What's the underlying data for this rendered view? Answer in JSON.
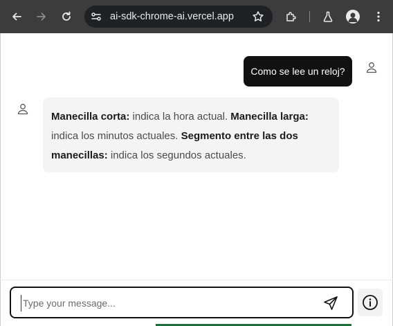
{
  "browser": {
    "url": "ai-sdk-chrome-ai.vercel.app",
    "icons": {
      "back": "arrow-left-icon",
      "forward": "arrow-right-icon",
      "reload": "reload-icon",
      "site_info": "tune-icon",
      "bookmark": "star-icon",
      "extensions": "puzzle-icon",
      "labs": "flask-icon",
      "profile": "person-icon",
      "menu": "kebab-menu-icon"
    }
  },
  "chat": {
    "messages": [
      {
        "role": "user",
        "text": "Como se lee un reloj?"
      },
      {
        "role": "assistant",
        "parts": [
          {
            "bold": true,
            "text": "Manecilla corta:"
          },
          {
            "bold": false,
            "text": " indica la hora actual. "
          },
          {
            "bold": true,
            "text": "Manecilla larga:"
          },
          {
            "bold": false,
            "text": " indica los minutos actuales. "
          },
          {
            "bold": true,
            "text": "Segmento entre las dos manecillas:"
          },
          {
            "bold": false,
            "text": " indica los segundos actuales."
          }
        ]
      }
    ]
  },
  "composer": {
    "placeholder": "Type your message...",
    "send_icon": "send-icon",
    "info_icon": "info-icon"
  },
  "colors": {
    "toolbar": "#3c3c3c",
    "omnibox": "#202124",
    "user_bubble": "#111111",
    "assistant_bubble": "#f4f4f4"
  }
}
